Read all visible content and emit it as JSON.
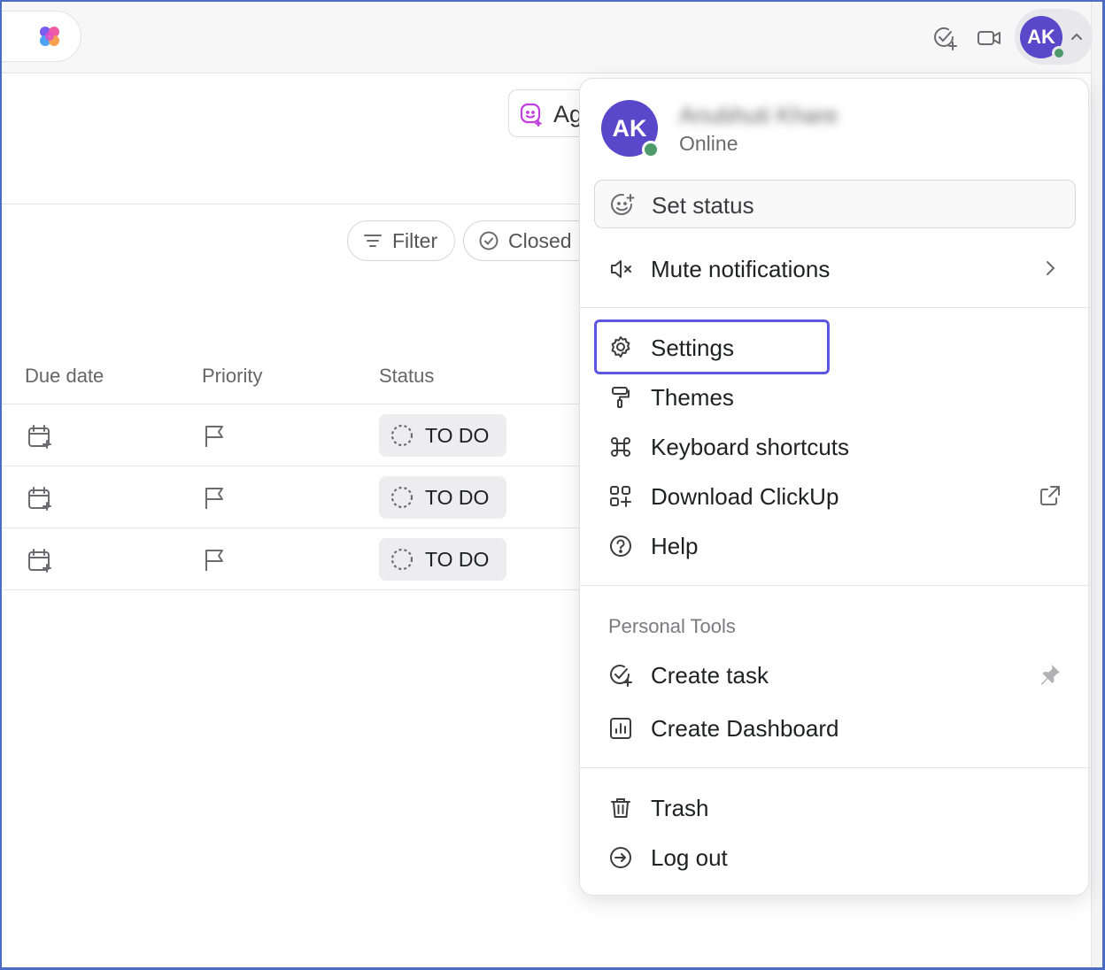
{
  "topbar": {
    "icons": [
      "app-logo-icon",
      "task-check-icon",
      "video-icon"
    ],
    "user_initials": "AK"
  },
  "background": {
    "ai_pill_label": "Ag",
    "filters": {
      "filter_label": "Filter",
      "closed_label": "Closed"
    },
    "columns": [
      "Due date",
      "Priority",
      "Status"
    ],
    "rows": [
      {
        "status": "TO DO"
      },
      {
        "status": "TO DO"
      },
      {
        "status": "TO DO"
      }
    ]
  },
  "menu": {
    "profile": {
      "initials": "AK",
      "name": "Anubhuti Khare",
      "presence": "Online"
    },
    "set_status": "Set status",
    "mute_notifications": "Mute notifications",
    "items": {
      "settings": "Settings",
      "themes": "Themes",
      "keyboard_shortcuts": "Keyboard shortcuts",
      "download": "Download ClickUp",
      "help": "Help"
    },
    "personal_tools": {
      "label": "Personal Tools",
      "create_task": "Create task",
      "create_dashboard": "Create Dashboard"
    },
    "trash": "Trash",
    "log_out": "Log out"
  },
  "colors": {
    "avatar": "#5b47c9",
    "online": "#4e9a6a",
    "focus_ring": "#5b57e0",
    "ai_accent": "#c23fe0"
  }
}
